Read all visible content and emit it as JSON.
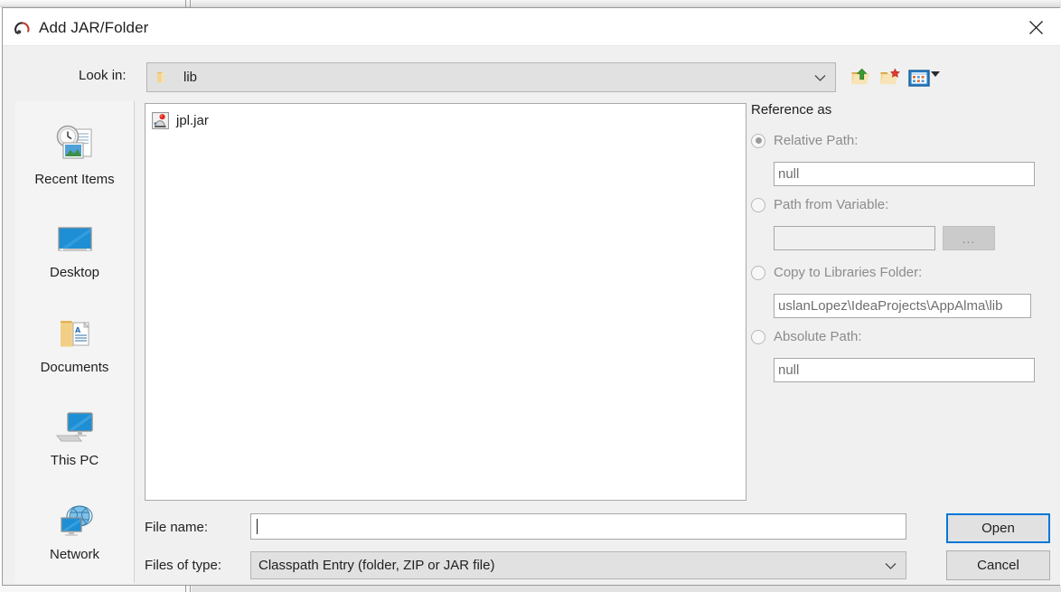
{
  "window": {
    "title": "Add JAR/Folder",
    "icon": "intellij-idea-icon",
    "close_label": "✕"
  },
  "toolbar": {
    "look_in_label": "Look in:",
    "look_in_value": "lib",
    "look_in_icon": "folder-icon",
    "buttons": [
      {
        "name": "up-one-level-button",
        "icon": "folder-up-arrow-icon",
        "tooltip": "Up One Level"
      },
      {
        "name": "create-new-folder-button",
        "icon": "folder-new-icon",
        "tooltip": "Create New Folder"
      },
      {
        "name": "view-menu-button",
        "icon": "grid-view-icon",
        "tooltip": "View"
      }
    ]
  },
  "sidebar": {
    "items": [
      {
        "label": "Recent Items",
        "icon": "recent-items-icon"
      },
      {
        "label": "Desktop",
        "icon": "desktop-icon"
      },
      {
        "label": "Documents",
        "icon": "documents-folder-icon"
      },
      {
        "label": "This PC",
        "icon": "this-pc-icon"
      },
      {
        "label": "Network",
        "icon": "network-icon"
      }
    ]
  },
  "file_list": {
    "files": [
      {
        "name": "jpl.jar",
        "icon": "jar-file-icon"
      }
    ]
  },
  "reference_panel": {
    "title": "Reference as",
    "options": [
      {
        "label": "Relative Path:",
        "selected": true,
        "value": "null",
        "has_browse": false,
        "field_empty": false
      },
      {
        "label": "Path from Variable:",
        "selected": false,
        "value": "",
        "has_browse": true,
        "browse_label": "...",
        "field_empty": true
      },
      {
        "label": "Copy to Libraries Folder:",
        "selected": false,
        "value": "uslanLopez\\IdeaProjects\\AppAlma\\lib",
        "has_browse": false,
        "field_empty": false
      },
      {
        "label": "Absolute Path:",
        "selected": false,
        "value": "null",
        "has_browse": false,
        "field_empty": false
      }
    ]
  },
  "bottom": {
    "file_name_label": "File name:",
    "file_name_value": "",
    "files_of_type_label": "Files of type:",
    "files_of_type_value": "Classpath Entry (folder, ZIP or JAR file)",
    "open_button": "Open",
    "cancel_button": "Cancel"
  },
  "colors": {
    "dialog_bg": "#f0f0f0",
    "titlebar_bg": "#ffffff",
    "accent_focus": "#0078d7",
    "field_bg": "#ffffff",
    "combo_bg": "#e1e1e1",
    "disabled_text": "#8c8c8c",
    "text": "#1f1f1f"
  }
}
